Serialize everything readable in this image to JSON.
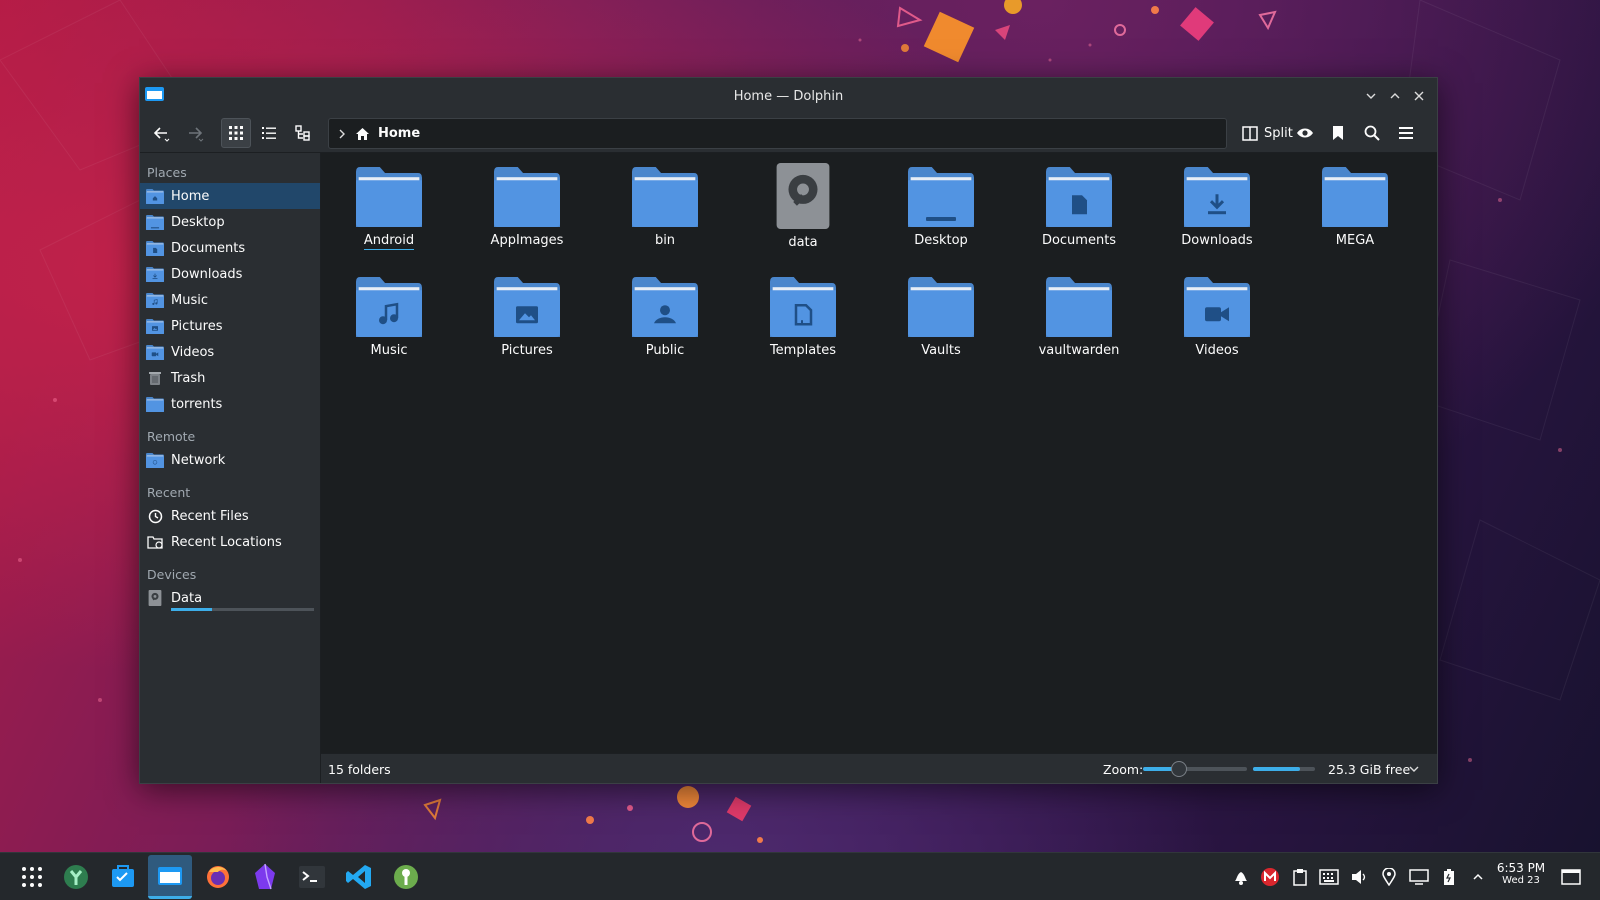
{
  "window": {
    "title": "Home — Dolphin"
  },
  "toolbar": {
    "breadcrumb_label": "Home",
    "split_label": "Split",
    "buttons": [
      "back-icon",
      "forward-icon",
      "icons-view-icon",
      "details-view-icon",
      "tree-view-icon",
      "preview-icon",
      "bookmark-icon",
      "search-icon",
      "hamburger-menu-icon"
    ]
  },
  "sidebar": {
    "places_title": "Places",
    "places": [
      {
        "label": "Home",
        "icon": "home-folder-icon",
        "selected": true
      },
      {
        "label": "Desktop",
        "icon": "desktop-folder-icon"
      },
      {
        "label": "Documents",
        "icon": "documents-folder-icon"
      },
      {
        "label": "Downloads",
        "icon": "downloads-folder-icon"
      },
      {
        "label": "Music",
        "icon": "music-folder-icon"
      },
      {
        "label": "Pictures",
        "icon": "pictures-folder-icon"
      },
      {
        "label": "Videos",
        "icon": "videos-folder-icon"
      },
      {
        "label": "Trash",
        "icon": "trash-icon"
      },
      {
        "label": "torrents",
        "icon": "folder-icon"
      }
    ],
    "remote_title": "Remote",
    "remote": [
      {
        "label": "Network",
        "icon": "network-folder-icon"
      }
    ],
    "recent_title": "Recent",
    "recent": [
      {
        "label": "Recent Files",
        "icon": "clock-icon"
      },
      {
        "label": "Recent Locations",
        "icon": "recent-locations-icon"
      }
    ],
    "devices_title": "Devices",
    "devices": [
      {
        "label": "Data",
        "icon": "drive-icon",
        "used_fraction": 0.29
      }
    ]
  },
  "folders": [
    {
      "name": "Android",
      "icon": "folder-icon"
    },
    {
      "name": "AppImages",
      "icon": "folder-icon"
    },
    {
      "name": "bin",
      "icon": "folder-icon"
    },
    {
      "name": "data",
      "icon": "drive-icon"
    },
    {
      "name": "Desktop",
      "icon": "desktop-folder-icon"
    },
    {
      "name": "Documents",
      "icon": "documents-folder-icon"
    },
    {
      "name": "Downloads",
      "icon": "downloads-folder-icon"
    },
    {
      "name": "MEGA",
      "icon": "folder-icon"
    },
    {
      "name": "Music",
      "icon": "music-folder-icon"
    },
    {
      "name": "Pictures",
      "icon": "pictures-folder-icon"
    },
    {
      "name": "Public",
      "icon": "public-folder-icon"
    },
    {
      "name": "Templates",
      "icon": "templates-folder-icon"
    },
    {
      "name": "Vaults",
      "icon": "folder-icon"
    },
    {
      "name": "vaultwarden",
      "icon": "folder-icon"
    },
    {
      "name": "Videos",
      "icon": "videos-folder-icon"
    }
  ],
  "statusbar": {
    "count_text": "15 folders",
    "zoom_label": "Zoom:",
    "zoom_level": 0.35,
    "used_space_fraction": 0.75,
    "free_text": "25.3 GiB free"
  },
  "taskbar": {
    "apps": [
      "app-launcher-icon",
      "scrcpy-icon",
      "discover-icon",
      "dolphin-icon",
      "firefox-icon",
      "obsidian-icon",
      "konsole-icon",
      "vscode-icon",
      "keepassxc-icon"
    ],
    "tray": [
      "notifications-icon",
      "mega-icon",
      "clipboard-icon",
      "keyboard-icon",
      "volume-icon",
      "location-icon",
      "display-icon",
      "battery-icon",
      "show-hidden-icon"
    ],
    "clock_time": "6:53 PM",
    "clock_date": "Wed 23"
  },
  "colors": {
    "accent": "#3daee9",
    "folder": "#5294e2",
    "selection": "#21476a",
    "window_bg": "#1b1e20",
    "chrome_bg": "#2a2e32"
  }
}
